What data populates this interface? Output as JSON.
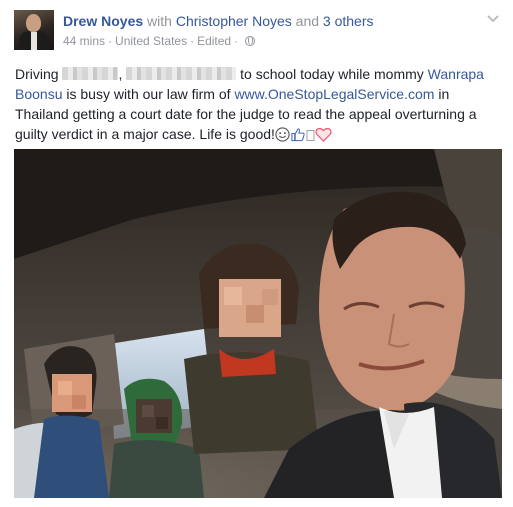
{
  "post": {
    "author": "Drew Noyes",
    "with_word": "with",
    "tagged_person": "Christopher Noyes",
    "and_word": "and",
    "others_link": "3 others",
    "time": "44 mins",
    "location": "United States",
    "edited": "Edited",
    "text": {
      "p1": "Driving",
      "p2": ",",
      "p3": "to school today while mommy",
      "mention": "Wanrapa Boonsu",
      "p4": "is busy with our law firm of",
      "url": "www.OneStopLegalService.com",
      "p5": "in Thailand getting a court date for the judge to read the appeal overturning a guilty verdict in a major case. Life is good!"
    },
    "icons": [
      "options-chevron-icon",
      "globe-icon",
      "smile-emoji-icon",
      "thumbs-up-emoji-icon",
      "heart-emoji-icon"
    ],
    "colors": {
      "link": "#365899",
      "meta": "#90949c",
      "text": "#1d2129",
      "heart": "#f25268"
    }
  }
}
